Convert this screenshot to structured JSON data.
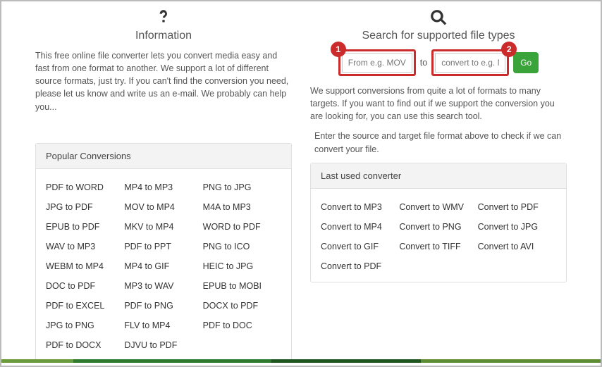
{
  "info": {
    "title": "Information",
    "text": "This free online file converter lets you convert media easy and fast from one format to another. We support a lot of different source formats, just try. If you can't find the conversion you need, please let us know and write us an e-mail. We probably can help you..."
  },
  "search": {
    "title": "Search for supported file types",
    "from_placeholder": "From e.g. MOV",
    "to_word": "to",
    "to_placeholder": "convert to e.g. MF",
    "go_label": "Go",
    "badge1": "1",
    "badge2": "2",
    "desc": "We support conversions from quite a lot of formats to many targets. If you want to find out if we support the conversion you are looking for, you can use this search tool.",
    "hint": "Enter the source and target file format above to check if we can convert your file."
  },
  "popular": {
    "title": "Popular Conversions",
    "cols": [
      [
        "PDF to WORD",
        "JPG to PDF",
        "EPUB to PDF",
        "WAV to MP3",
        "WEBM to MP4",
        "DOC to PDF",
        "PDF to EXCEL",
        "JPG to PNG",
        "PDF to DOCX"
      ],
      [
        "MP4 to MP3",
        "MOV to MP4",
        "MKV to MP4",
        "PDF to PPT",
        "MP4 to GIF",
        "MP3 to WAV",
        "PDF to PNG",
        "FLV to MP4",
        "DJVU to PDF"
      ],
      [
        "PNG to JPG",
        "M4A to MP3",
        "WORD to PDF",
        "PNG to ICO",
        "HEIC to JPG",
        "EPUB to MOBI",
        "DOCX to PDF",
        "PDF to DOC"
      ]
    ]
  },
  "last": {
    "title": "Last used converter",
    "cols": [
      [
        "Convert to MP3",
        "Convert to MP4",
        "Convert to GIF",
        "Convert to PDF"
      ],
      [
        "Convert to WMV",
        "Convert to PNG",
        "Convert to TIFF"
      ],
      [
        "Convert to PDF",
        "Convert to JPG",
        "Convert to AVI"
      ]
    ]
  }
}
